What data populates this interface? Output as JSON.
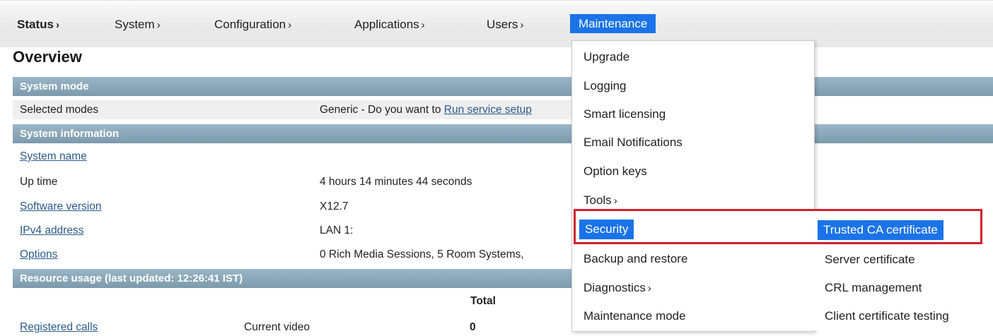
{
  "nav": {
    "status": "Status",
    "system": "System",
    "configuration": "Configuration",
    "applications": "Applications",
    "users": "Users",
    "maintenance": "Maintenance",
    "chevron": "›"
  },
  "page_title": "Overview",
  "sections": {
    "system_mode": "System mode",
    "system_information": "System information",
    "resource_usage": "Resource usage (last updated: 12:26:41 IST)"
  },
  "system_mode": {
    "selected_modes_label": "Selected modes",
    "selected_modes_value_prefix": "Generic - Do you want to ",
    "selected_modes_link": "Run service setup"
  },
  "system_info": {
    "system_name_label": "System name",
    "up_time_label": "Up time",
    "up_time_value": "4 hours 14 minutes 44 seconds",
    "software_version_label": "Software version",
    "software_version_value": "X12.7",
    "ipv4_label": "IPv4 address",
    "ipv4_value": "LAN 1:",
    "options_label": "Options",
    "options_value": "0 Rich Media Sessions, 5 Room Systems,"
  },
  "resource_usage": {
    "total_header": "Total",
    "registered_calls": "Registered calls",
    "current_video": "Current video",
    "current_video_total": "0"
  },
  "maintenance_menu": {
    "items": [
      "Upgrade",
      "Logging",
      "Smart licensing",
      "Email Notifications",
      "Option keys",
      "Tools",
      "Security",
      "Backup and restore",
      "Diagnostics",
      "Maintenance mode"
    ]
  },
  "security_submenu": {
    "items": [
      "Trusted CA certificate",
      "Server certificate",
      "CRL management",
      "Client certificate testing"
    ]
  },
  "colors": {
    "accent": "#1a73e8",
    "section_header": "#87a3b4",
    "highlight_box": "#d21f2c",
    "link": "#2a5a8a"
  }
}
